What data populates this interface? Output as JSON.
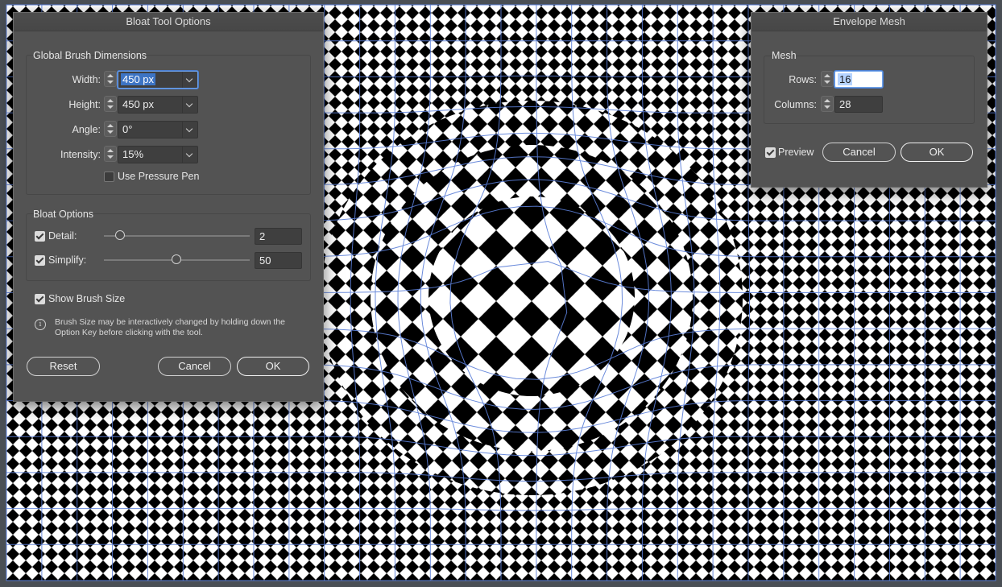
{
  "bloat_dialog": {
    "title": "Bloat Tool Options",
    "global_group_title": "Global Brush Dimensions",
    "width": {
      "label": "Width:",
      "value": "450 px"
    },
    "height": {
      "label": "Height:",
      "value": "450 px"
    },
    "angle": {
      "label": "Angle:",
      "value": "0°"
    },
    "intensity": {
      "label": "Intensity:",
      "value": "15%"
    },
    "use_pressure_pen": {
      "label": "Use Pressure Pen",
      "checked": false
    },
    "options_group_title": "Bloat Options",
    "detail": {
      "label": "Detail:",
      "value": "2",
      "checked": true,
      "level": 2,
      "range": [
        1,
        10
      ]
    },
    "simplify": {
      "label": "Simplify:",
      "value": "50",
      "checked": true,
      "level": 50,
      "range": [
        0.2,
        100
      ]
    },
    "show_brush_size": {
      "label": "Show Brush Size",
      "checked": true
    },
    "note_line1": "Brush Size may be interactively changed by holding down the",
    "note_line2": "Option Key before clicking with the tool.",
    "reset_label": "Reset",
    "cancel_label": "Cancel",
    "ok_label": "OK"
  },
  "envelope_dialog": {
    "title": "Envelope Mesh",
    "group_title": "Mesh",
    "rows": {
      "label": "Rows:",
      "value": "16"
    },
    "columns": {
      "label": "Columns:",
      "value": "28"
    },
    "preview": {
      "label": "Preview",
      "checked": true
    },
    "cancel_label": "Cancel",
    "ok_label": "OK"
  },
  "artwork": {
    "pattern": "black-white-diamond-checkerboard",
    "effect": "bloat",
    "mesh_line_color": "#5b7fd8",
    "selection_frame_color": "#5b7fd8"
  }
}
